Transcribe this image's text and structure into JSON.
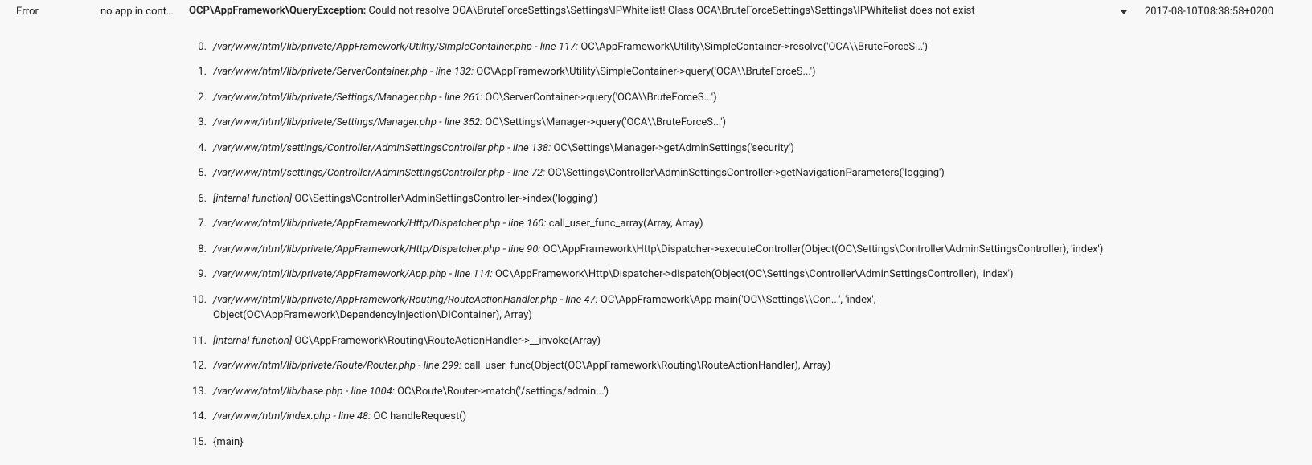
{
  "row": {
    "level": "Error",
    "app": "no app in cont…",
    "message_prefix": "OCP\\AppFramework\\QueryException:",
    "message_body": " Could not resolve OCA\\BruteForceSettings\\Settings\\IPWhitelist! Class OCA\\BruteForceSettings\\Settings\\IPWhitelist does not exist",
    "timestamp": "2017-08-10T08:38:58+0200"
  },
  "trace": [
    {
      "file": "/var/www/html/lib/private/AppFramework/Utility/SimpleContainer.php",
      "line": " - line 117:",
      "call": "OC\\AppFramework\\Utility\\SimpleContainer->resolve('OCA\\\\BruteForceS...')"
    },
    {
      "file": "/var/www/html/lib/private/ServerContainer.php",
      "line": " - line 132:",
      "call": "OC\\AppFramework\\Utility\\SimpleContainer->query('OCA\\\\BruteForceS...')"
    },
    {
      "file": "/var/www/html/lib/private/Settings/Manager.php",
      "line": " - line 261:",
      "call": "OC\\ServerContainer->query('OCA\\\\BruteForceS...')"
    },
    {
      "file": "/var/www/html/lib/private/Settings/Manager.php",
      "line": " - line 352:",
      "call": "OC\\Settings\\Manager->query('OCA\\\\BruteForceS...')"
    },
    {
      "file": "/var/www/html/settings/Controller/AdminSettingsController.php",
      "line": " - line 138:",
      "call": "OC\\Settings\\Manager->getAdminSettings('security')"
    },
    {
      "file": "/var/www/html/settings/Controller/AdminSettingsController.php",
      "line": " - line 72:",
      "call": "OC\\Settings\\Controller\\AdminSettingsController->getNavigationParameters('logging')"
    },
    {
      "file": "[internal function]",
      "line": "",
      "call": "OC\\Settings\\Controller\\AdminSettingsController->index('logging')"
    },
    {
      "file": "/var/www/html/lib/private/AppFramework/Http/Dispatcher.php",
      "line": " - line 160:",
      "call": "call_user_func_array(Array, Array)"
    },
    {
      "file": "/var/www/html/lib/private/AppFramework/Http/Dispatcher.php",
      "line": " - line 90:",
      "call": "OC\\AppFramework\\Http\\Dispatcher->executeController(Object(OC\\Settings\\Controller\\AdminSettingsController), 'index')"
    },
    {
      "file": "/var/www/html/lib/private/AppFramework/App.php",
      "line": " - line 114:",
      "call": "OC\\AppFramework\\Http\\Dispatcher->dispatch(Object(OC\\Settings\\Controller\\AdminSettingsController), 'index')"
    },
    {
      "file": "/var/www/html/lib/private/AppFramework/Routing/RouteActionHandler.php",
      "line": " - line 47:",
      "call": "OC\\AppFramework\\App main('OC\\\\Settings\\\\Con...', 'index', Object(OC\\AppFramework\\DependencyInjection\\DIContainer), Array)"
    },
    {
      "file": "[internal function]",
      "line": "",
      "call": "OC\\AppFramework\\Routing\\RouteActionHandler->__invoke(Array)"
    },
    {
      "file": "/var/www/html/lib/private/Route/Router.php",
      "line": " - line 299:",
      "call": "call_user_func(Object(OC\\AppFramework\\Routing\\RouteActionHandler), Array)"
    },
    {
      "file": "/var/www/html/lib/base.php",
      "line": " - line 1004:",
      "call": "OC\\Route\\Router->match('/settings/admin...')"
    },
    {
      "file": "/var/www/html/index.php",
      "line": " - line 48:",
      "call": "OC handleRequest()"
    },
    {
      "file": "",
      "line": "",
      "call": "{main}"
    }
  ]
}
